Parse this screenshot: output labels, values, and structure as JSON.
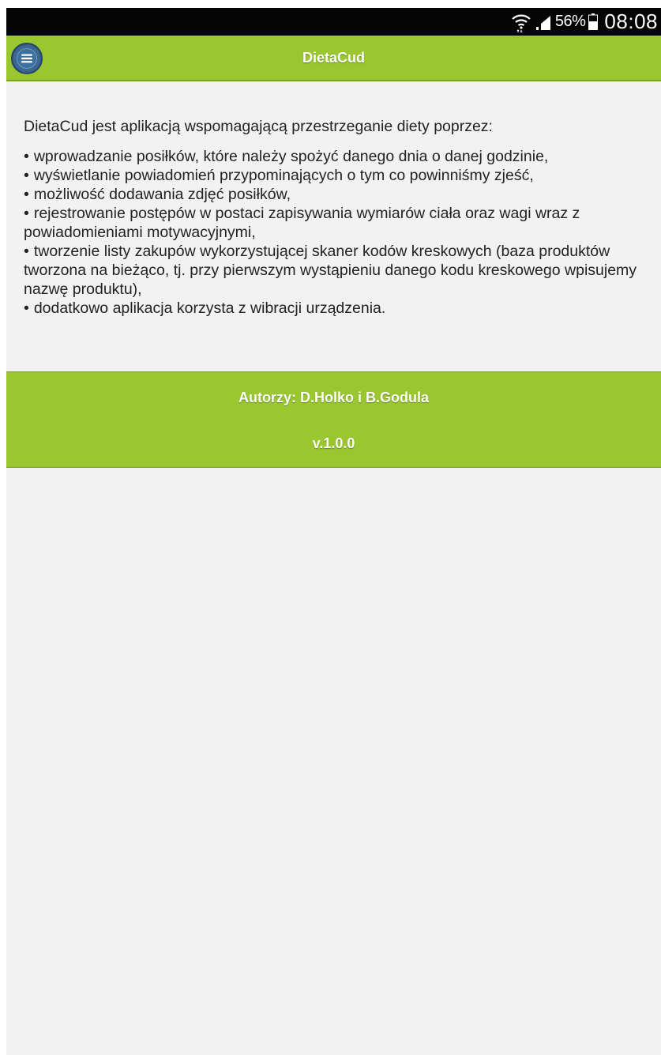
{
  "status_bar": {
    "battery_percent": "56%",
    "time": "08:08",
    "icons": [
      "wifi-icon",
      "signal-icon",
      "battery-icon"
    ]
  },
  "header": {
    "title": "DietaCud",
    "menu_icon": "menu-icon"
  },
  "content": {
    "intro": "DietaCud jest aplikacją wspomagającą przestrzeganie diety poprzez:",
    "features": [
      "wprowadzanie posiłków, które należy spożyć danego dnia o danej godzinie,",
      "wyświetlanie powiadomień przypominających o tym co powinniśmy zjeść,",
      "możliwość dodawania zdjęć posiłków,",
      "rejestrowanie postępów w postaci zapisywania wymiarów ciała oraz wagi wraz z powiadomieniami motywacyjnymi,",
      "tworzenie listy zakupów wykorzystującej skaner kodów kreskowych (baza produktów tworzona na bieżąco, tj. przy pierwszym wystąpieniu danego kodu kreskowego wpisujemy nazwę produktu),",
      "dodatkowo aplikacja korzysta z wibracji urządzenia."
    ],
    "bullet": "•"
  },
  "footer": {
    "authors": "Autorzy: D.Holko i B.Godula",
    "version": "v.1.0.0"
  },
  "colors": {
    "accent_green": "#9ac730",
    "status_bar": "#050505",
    "background": "#f2f2f2",
    "menu_button": "#3d6691"
  }
}
